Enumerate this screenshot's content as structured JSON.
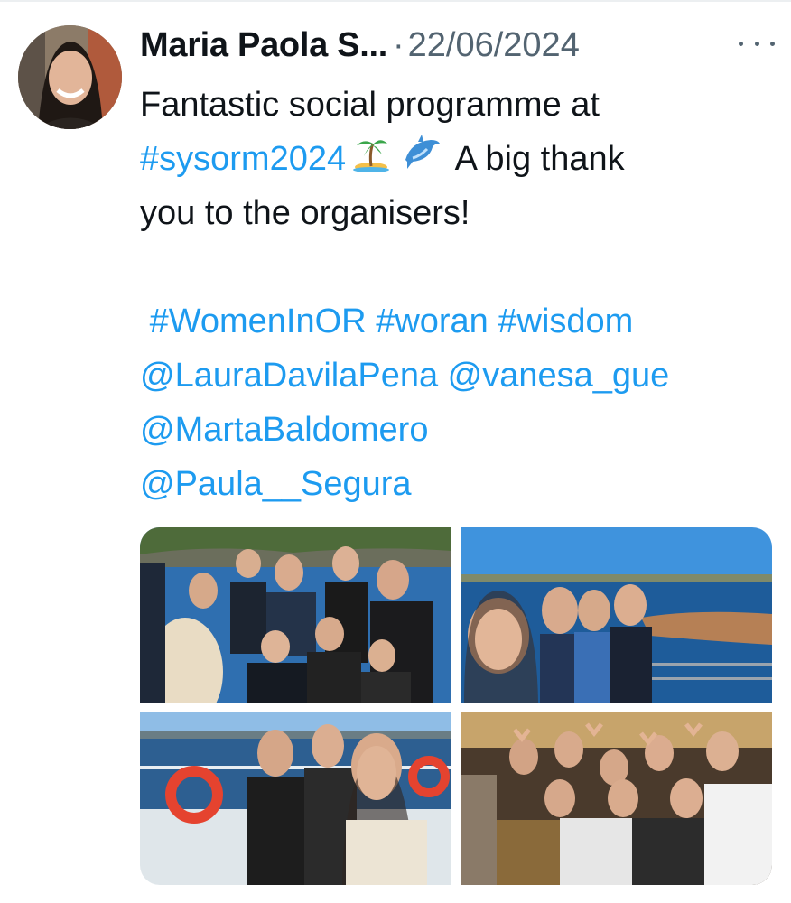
{
  "post": {
    "author": "Maria Paola S...",
    "separator": "·",
    "date": "22/06/2024",
    "text": {
      "l1": "Fantastic social programme at",
      "l2_hashtag": "#sysorm2024",
      "l2_text": "A big thank",
      "l3": "you to the organisers!",
      "l5_tags": [
        "#WomenInOR",
        "#woran",
        "#wisdom"
      ],
      "l6_mentions": [
        "@LauraDavilaPena",
        "@vanesa_gue"
      ],
      "l7_mention": "@MartaBaldomero",
      "l8_mention": "@Paula__Segura"
    },
    "emojis": [
      "island-emoji",
      "dolphin-emoji"
    ]
  },
  "photos": [
    {
      "id": "photo-group-coast",
      "scene": "group of women posing by the sea"
    },
    {
      "id": "photo-selfie-sea",
      "scene": "selfie in front of the bay"
    },
    {
      "id": "photo-boat",
      "scene": "selfie on a boat with life ring"
    },
    {
      "id": "photo-party",
      "scene": "group making heart hands at a bar"
    }
  ],
  "colors": {
    "link": "#1d9bf0",
    "text": "#0f1419",
    "muted": "#536471"
  }
}
